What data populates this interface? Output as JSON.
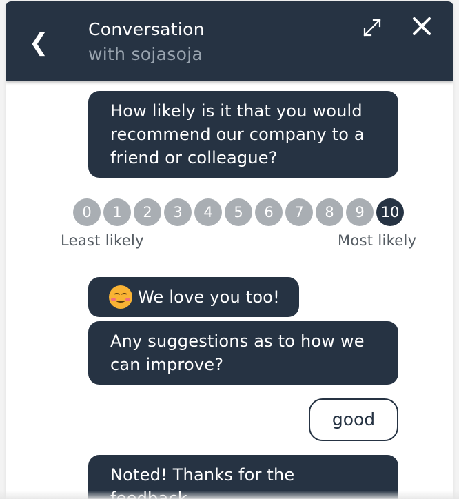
{
  "header": {
    "back_glyph": "❮",
    "title": "Conversation",
    "subtitle": "with sojasoja",
    "expand_icon": "expand-icon",
    "close_icon": "close-icon"
  },
  "colors": {
    "header_bg": "#263343",
    "bubble_bg": "#263343",
    "scale_inactive": "#a9aeb3",
    "scale_selected": "#263343"
  },
  "messages": [
    {
      "from": "agent",
      "text": "How likely is it that you would recommend our company to a friend or colleague?"
    },
    {
      "from": "agent",
      "text": "We love you too!",
      "icon": "smiling-face-icon"
    },
    {
      "from": "agent",
      "text": "Any suggestions as to how we can improve?"
    },
    {
      "from": "user",
      "text": "good"
    },
    {
      "from": "agent",
      "text": "Noted! Thanks for the feedback."
    }
  ],
  "rating_scale": {
    "options": [
      "0",
      "1",
      "2",
      "3",
      "4",
      "5",
      "6",
      "7",
      "8",
      "9",
      "10"
    ],
    "selected": "10",
    "low_label": "Least likely",
    "high_label": "Most likely"
  }
}
